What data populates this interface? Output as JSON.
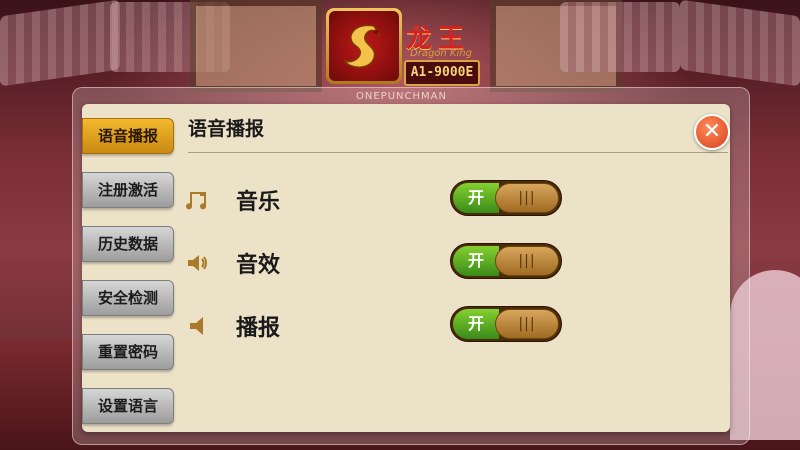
{
  "logo": {
    "name": "龙王",
    "english": "Dragon King",
    "code": "A1-9000E"
  },
  "background_credit": "ONEPUNCHMAN",
  "sidebar": {
    "tabs": [
      {
        "label": "语音播报",
        "active": true
      },
      {
        "label": "注册激活",
        "active": false
      },
      {
        "label": "历史数据",
        "active": false
      },
      {
        "label": "安全检测",
        "active": false
      },
      {
        "label": "重置密码",
        "active": false
      },
      {
        "label": "设置语言",
        "active": false
      }
    ]
  },
  "panel": {
    "title": "语音播报",
    "close_label": "✕"
  },
  "settings": [
    {
      "label": "音乐",
      "icon": "music-note-icon",
      "state": "开",
      "knob": "|||",
      "on": true
    },
    {
      "label": "音效",
      "icon": "speaker-icon",
      "state": "开",
      "knob": "|||",
      "on": true
    },
    {
      "label": "播报",
      "icon": "speaker-broadcast-icon",
      "state": "开",
      "knob": "|||",
      "on": true
    }
  ],
  "colors": {
    "accent": "#f2b92e",
    "toggle_on": "#6cc02a",
    "close": "#e0502a"
  }
}
